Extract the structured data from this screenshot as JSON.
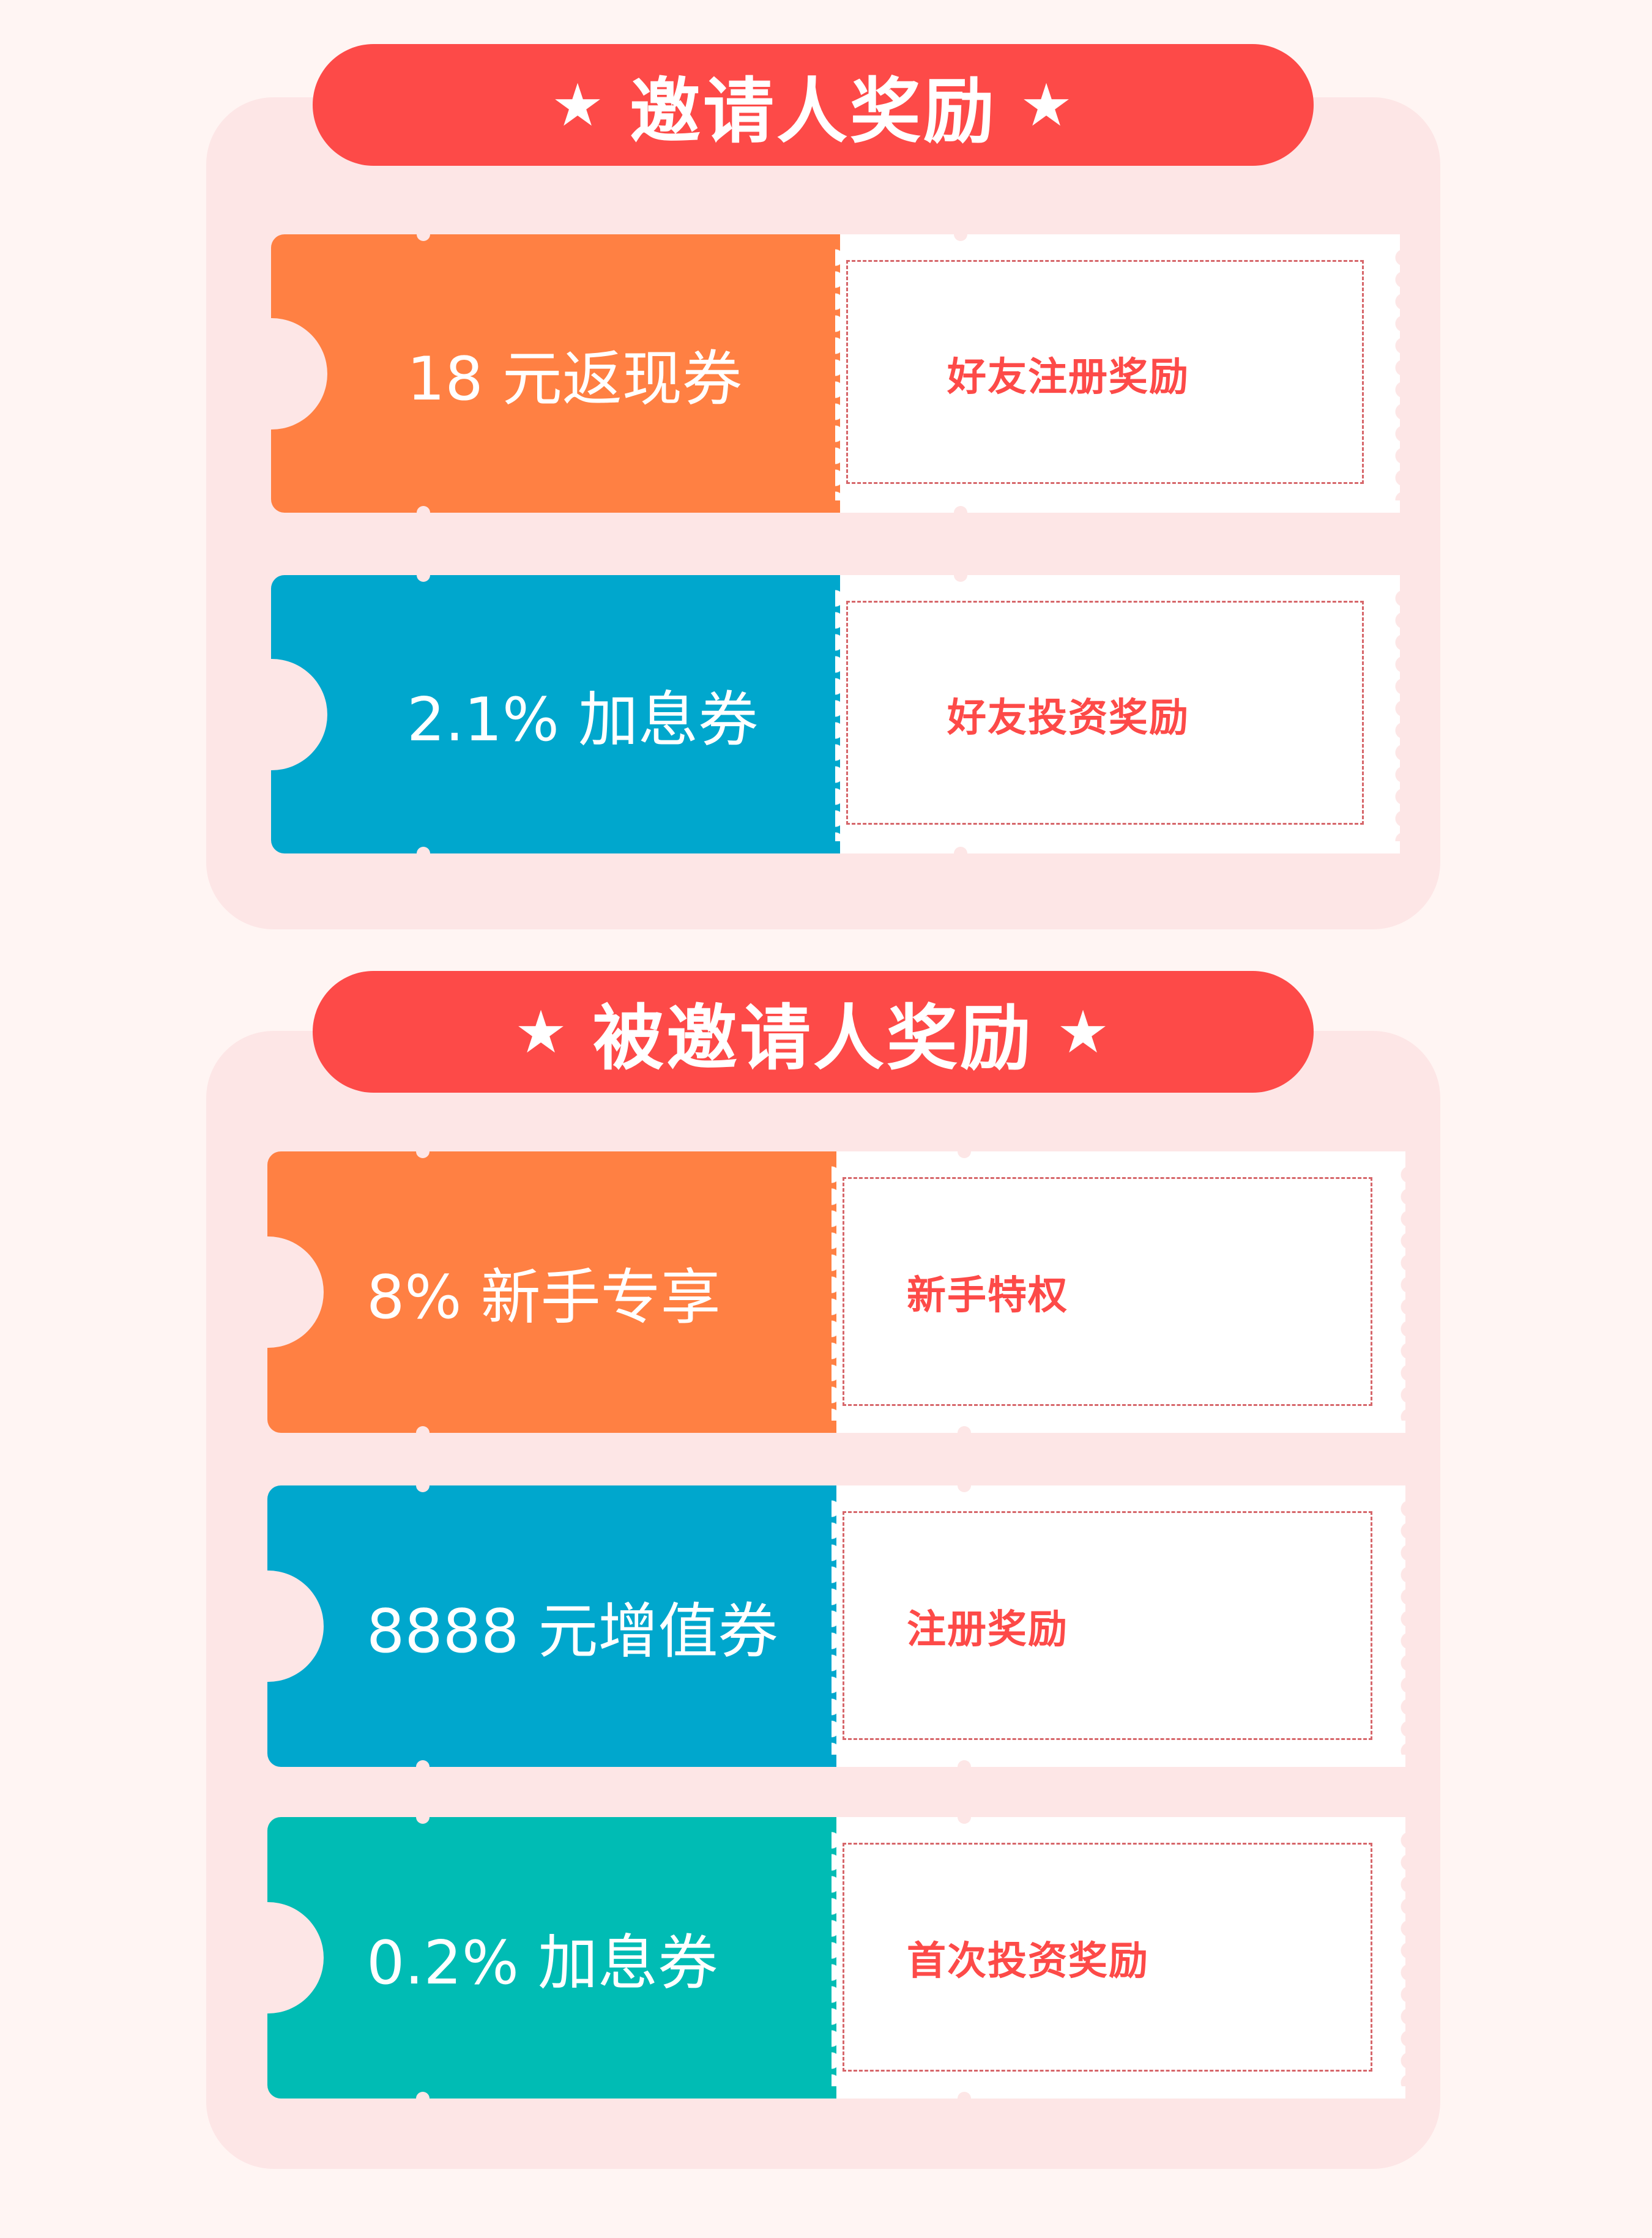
{
  "colors": {
    "page_background": "#fff5f3",
    "panel_background": "#fde6e6",
    "banner": "#fd4a48",
    "orange": "#ff8043",
    "blue": "#00a7cd",
    "teal": "#00bcb4",
    "reward_text": "#fd4a48",
    "dashed_border": "#d6666a"
  },
  "sections": [
    {
      "title": "邀请人奖励",
      "star": "★",
      "coupons": [
        {
          "value": "18 元返现券",
          "reward": "好友注册奖励",
          "color": "orange"
        },
        {
          "value": "2.1% 加息券",
          "reward": "好友投资奖励",
          "color": "blue"
        }
      ]
    },
    {
      "title": "被邀请人奖励",
      "star": "★",
      "coupons": [
        {
          "value": "8% 新手专享",
          "reward": "新手特权",
          "color": "orange"
        },
        {
          "value": "8888 元增值券",
          "reward": "注册奖励",
          "color": "blue"
        },
        {
          "value": "0.2% 加息券",
          "reward": "首次投资奖励",
          "color": "teal"
        }
      ]
    }
  ]
}
